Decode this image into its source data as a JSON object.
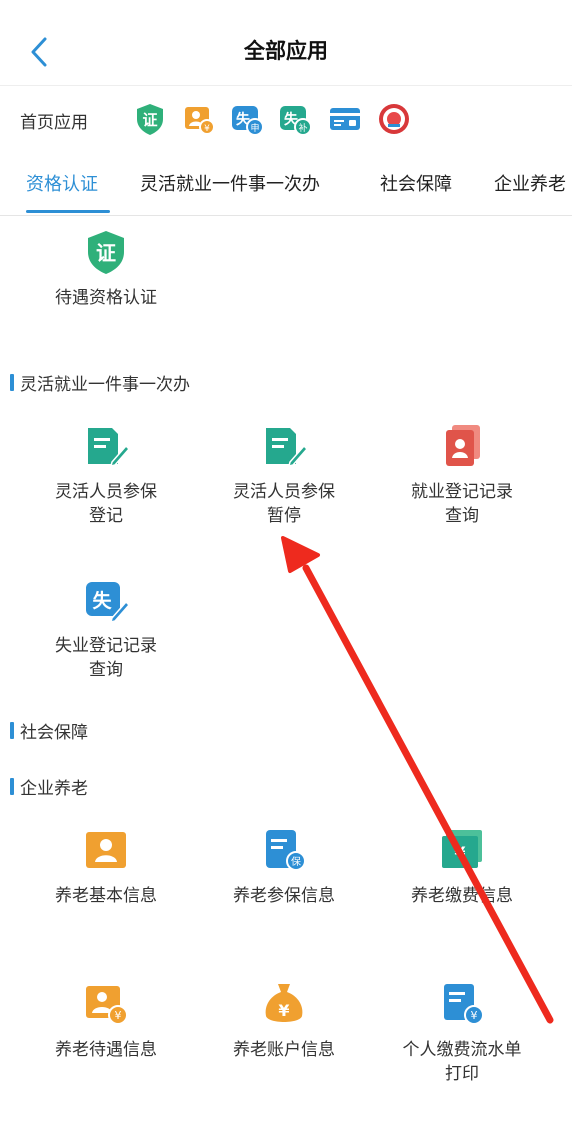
{
  "header": {
    "title": "全部应用"
  },
  "home_apps": {
    "label": "首页应用",
    "icons": [
      "cert-icon",
      "pension-person-icon",
      "unemployment-apply-icon",
      "unemployment-subsidy-icon",
      "card-icon",
      "emblem-icon"
    ],
    "badges": {
      "cert": "证",
      "shen_main": "失",
      "shen_sub": "申",
      "bu_main": "失",
      "bu_sub": "补",
      "yen": "¥"
    }
  },
  "tabs": [
    "资格认证",
    "灵活就业一件事一次办",
    "社会保障",
    "企业养老"
  ],
  "active_tab": "资格认证",
  "sections": {
    "qualification": {
      "items": [
        {
          "label": "待遇资格认证",
          "icon": "cert-icon"
        }
      ]
    },
    "flexible": {
      "title": "灵活就业一件事一次办",
      "items": [
        {
          "label": "灵活人员参保\n登记",
          "icon": "document-edit-icon"
        },
        {
          "label": "灵活人员参保\n暂停",
          "icon": "document-edit-icon"
        },
        {
          "label": "就业登记记录\n查询",
          "icon": "profile-card-icon"
        },
        {
          "label": "失业登记记录\n查询",
          "icon": "unemployment-edit-icon",
          "badge": "失"
        }
      ]
    },
    "social": {
      "title": "社会保障"
    },
    "pension": {
      "title": "企业养老",
      "items": [
        {
          "label": "养老基本信息",
          "icon": "person-card-icon"
        },
        {
          "label": "养老参保信息",
          "icon": "insurance-doc-icon",
          "badge": "保"
        },
        {
          "label": "养老缴费信息",
          "icon": "payment-card-icon",
          "badge": "¥"
        },
        {
          "label": "养老待遇信息",
          "icon": "person-money-icon",
          "badge": "¥"
        },
        {
          "label": "养老账户信息",
          "icon": "money-bag-icon",
          "badge": "¥"
        },
        {
          "label": "个人缴费流水单\n打印",
          "icon": "receipt-print-icon",
          "badge": "¥"
        }
      ]
    }
  },
  "colors": {
    "accent": "#2d8fd5",
    "green": "#2fb07a",
    "orange": "#f0a030",
    "red": "#e0544a",
    "arrow": "#ee2a1e"
  }
}
